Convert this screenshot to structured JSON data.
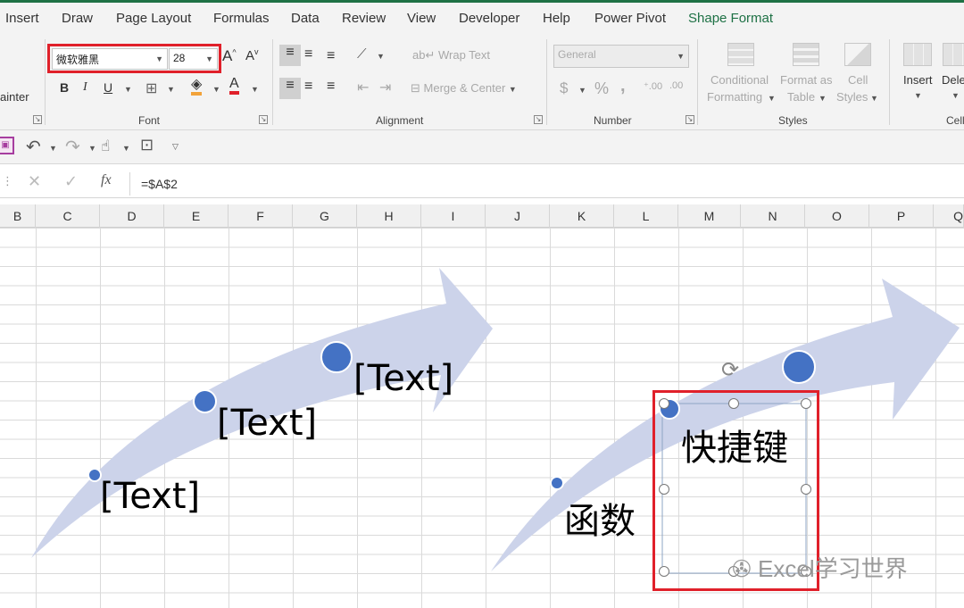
{
  "tabs": [
    "Insert",
    "Draw",
    "Page Layout",
    "Formulas",
    "Data",
    "Review",
    "View",
    "Developer",
    "Help",
    "Power Pivot",
    "Shape Format"
  ],
  "ribbon": {
    "painter_label": "ainter",
    "font": {
      "name": "微软雅黑",
      "size": "28",
      "group_label": "Font",
      "bold": "B",
      "italic": "I",
      "underline": "U",
      "font_color_letter": "A"
    },
    "alignment": {
      "wrap_text": "Wrap Text",
      "merge_center": "Merge & Center",
      "group_label": "Alignment"
    },
    "number": {
      "format": "General",
      "currency": "$",
      "percent": "%",
      "comma": ",",
      "group_label": "Number"
    },
    "styles": {
      "conditional_1": "Conditional",
      "conditional_2": "Formatting",
      "format_as_1": "Format as",
      "format_as_2": "Table",
      "cell_styles_1": "Cell",
      "cell_styles_2": "Styles",
      "group_label": "Styles"
    },
    "cells": {
      "insert": "Insert",
      "delete": "Dele",
      "group_label": "Cell"
    }
  },
  "formula_bar": {
    "formula": "=$A$2",
    "fx": "fx"
  },
  "columns": [
    "B",
    "C",
    "D",
    "E",
    "F",
    "G",
    "H",
    "I",
    "J",
    "K",
    "L",
    "M",
    "N",
    "O",
    "P",
    "Q"
  ],
  "smartart_left": {
    "labels": [
      "[Text]",
      "[Text]",
      "[Text]"
    ]
  },
  "smartart_right": {
    "labels": [
      "函数",
      "快捷键"
    ]
  },
  "watermark": "Excel学习世界",
  "colors": {
    "accent": "#1e7145",
    "arrow": "#ccd3ea",
    "dot": "#4472c4",
    "highlight": "#e0202a"
  }
}
